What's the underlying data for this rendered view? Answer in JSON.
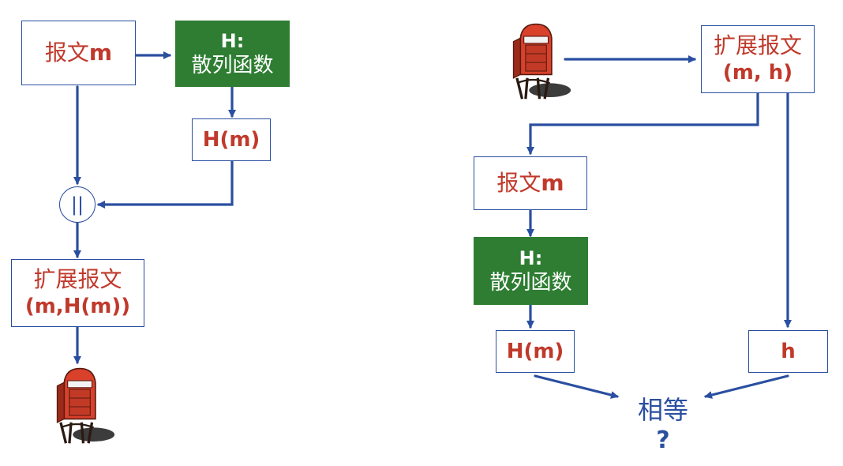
{
  "left": {
    "message_box": {
      "label": "报文",
      "var": "m"
    },
    "hash_box": {
      "title": "H:",
      "subtitle": "散列函数"
    },
    "hm_box": {
      "label": "H(m)"
    },
    "concat": {
      "symbol": "||"
    },
    "extended_box": {
      "title": "扩展报文",
      "sub": "(m,H(m))"
    }
  },
  "right": {
    "extended_box": {
      "title": "扩展报文",
      "sub": "(m, h)"
    },
    "message_box": {
      "label": "报文",
      "var": "m"
    },
    "hash_box": {
      "title": "H:",
      "subtitle": "散列函数"
    },
    "hm_box": {
      "label": "H(m)"
    },
    "h_box": {
      "label": "h"
    },
    "compare": {
      "label": "相等",
      "question": "?"
    }
  },
  "icons": [
    "mailbox-icon-sender",
    "mailbox-icon-receiver"
  ],
  "colors": {
    "arrow": "#2a4fa0",
    "text_red": "#c0392b",
    "hash_green": "#2e7d32",
    "mailbox_red": "#d9412b"
  }
}
